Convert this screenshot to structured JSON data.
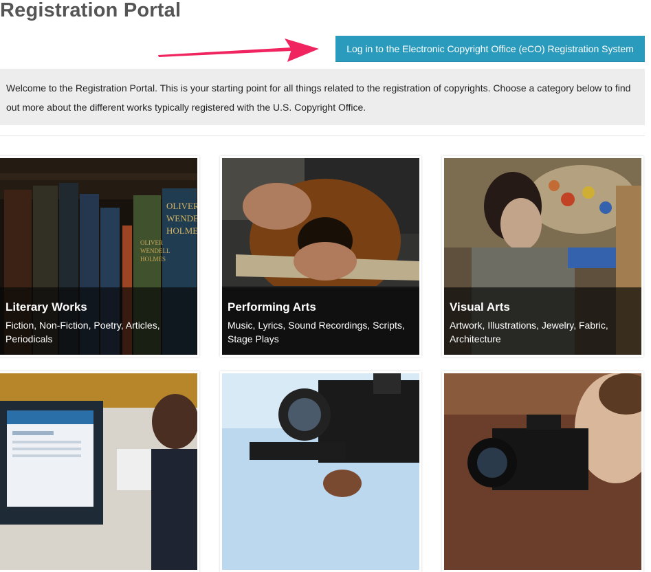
{
  "page": {
    "title": "Registration Portal",
    "login_button": "Log in to the Electronic Copyright Office (eCO) Registration System",
    "welcome": "Welcome to the Registration Portal. This is your starting point for all things related to the registration of copyrights. Choose a category below to find out more about the different works typically registered with the U.S. Copyright Office."
  },
  "colors": {
    "accent": "#2a9bbd",
    "arrow": "#f0245f",
    "banner": "#ededed",
    "title": "#555555"
  },
  "categories": [
    {
      "title": "Literary Works",
      "description": "Fiction, Non-Fiction, Poetry, Articles, Periodicals"
    },
    {
      "title": "Performing Arts",
      "description": "Music, Lyrics, Sound Recordings, Scripts, Stage Plays"
    },
    {
      "title": "Visual Arts",
      "description": "Artwork, Illustrations, Jewelry, Fabric, Architecture"
    },
    {
      "title": "",
      "description": ""
    },
    {
      "title": "",
      "description": ""
    },
    {
      "title": "",
      "description": ""
    }
  ],
  "book_spines": [
    {
      "line1": "OLIVER",
      "line2": "WENDELL",
      "line3": "HOLMES"
    },
    {
      "line1": "OLIVER",
      "line2": "WENDELL",
      "line3": "HOLMES"
    }
  ]
}
